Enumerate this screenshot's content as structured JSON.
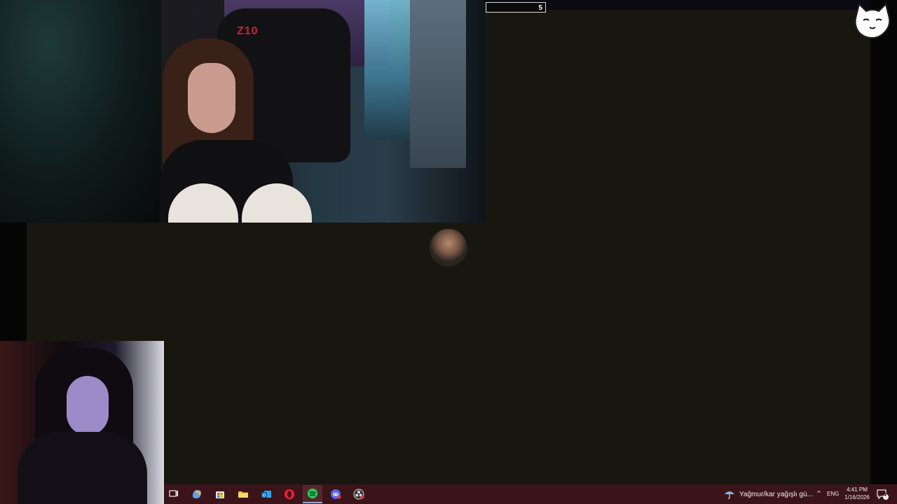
{
  "stream": {
    "counter_value": "5",
    "main_cam": {
      "chair_logo": "Z10"
    }
  },
  "taskbar": {
    "icons": [
      {
        "name": "task-view-icon",
        "label": "Task View"
      },
      {
        "name": "copilot-icon",
        "label": "Copilot"
      },
      {
        "name": "microsoft-store-icon",
        "label": "Microsoft Store"
      },
      {
        "name": "file-explorer-icon",
        "label": "File Explorer"
      },
      {
        "name": "outlook-icon",
        "label": "Outlook"
      },
      {
        "name": "opera-icon",
        "label": "Opera"
      },
      {
        "name": "spotify-icon",
        "label": "Spotify"
      },
      {
        "name": "discord-icon",
        "label": "Discord"
      },
      {
        "name": "obs-icon",
        "label": "OBS Studio"
      }
    ],
    "active_icon": "spotify-icon",
    "weather_text": "Yağmur/kar yağışlı gü...",
    "language": "ENG",
    "time": "4:41 PM",
    "date": "1/16/2026",
    "notification_count": "4",
    "colors": {
      "taskbar_bg": "#3a1419",
      "accent": "#9aa6cf"
    }
  }
}
